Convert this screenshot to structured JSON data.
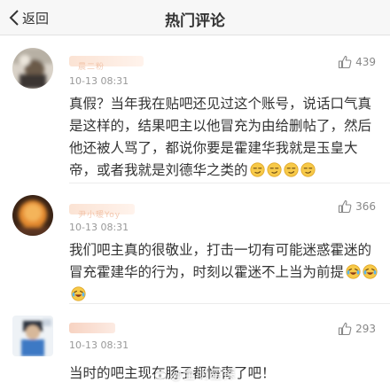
{
  "navbar": {
    "back_label": "返回",
    "title": "热门评论"
  },
  "comments": [
    {
      "username": "晨二粉",
      "time": "10-13 08:31",
      "likes": "439",
      "text": "真假？当年我在贴吧还见过这个账号，说话口气真是这样的，结果吧主以他冒充为由给删帖了，然后他还被人骂了，都说你要是霍建华我就是玉皇大帝，或者我就是刘德华之类的"
    },
    {
      "username": "尹小暖Yoy",
      "time": "10-13 08:31",
      "likes": "366",
      "text": "我们吧主真的很敬业，打击一切有可能迷惑霍迷的冒充霍建华的行为，时刻以霍迷不上当为前提"
    },
    {
      "username": "",
      "time": "10-13 08:31",
      "likes": "293",
      "text": "当时的吧主现在肠子都悔青了吧！"
    }
  ],
  "watermark": "@全明星探",
  "colors": {
    "navbar_bg": "#f7f7f7",
    "timestamp": "#999999",
    "text": "#333333",
    "like": "#888888"
  },
  "icons": [
    "chevron-left-icon",
    "thumbs-up-icon",
    "smirk-emoji-icon",
    "laughing-tears-emoji-icon"
  ]
}
